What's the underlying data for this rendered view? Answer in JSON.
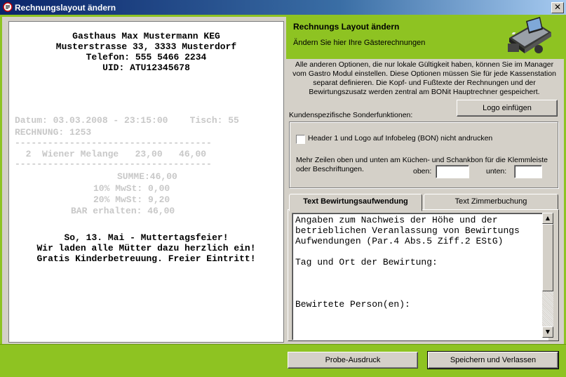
{
  "window": {
    "title": "Rechnungslayout ändern",
    "close_label": "✕"
  },
  "receipt": {
    "header_lines": [
      "Gasthaus Max Mustermann KEG",
      "Musterstrasse 33, 3333 Musterdorf",
      "Telefon: 555 5466 2234",
      "UID: ATU12345678"
    ],
    "datum_line": "Datum: 03.03.2008 - 23:15:00    Tisch: 55",
    "rechnung_line": "RECHNUNG: 1253",
    "separator": "------------------------------------",
    "item_line": "  2  Wiener Melange   23,00   46,00",
    "summe_line": "SUMME:46,00",
    "mwst10_line": "10% MwSt: 0,00",
    "mwst20_line": "20% MwSt: 9,20",
    "bar_line": "BAR erhalten: 46,00",
    "footer_lines": [
      "So, 13. Mai - Muttertagsfeier!",
      "Wir laden alle Mütter dazu herzlich ein!",
      "Gratis Kinderbetreuung. Freier Eintritt!"
    ]
  },
  "header": {
    "title": "Rechnungs Layout ändern",
    "subtitle": "Ändern Sie hier Ihre Gästerechnungen",
    "icon": "pos-terminal-icon"
  },
  "info_text": "Alle anderen Optionen, die nur lokale Gültigkeit haben, können Sie im Manager vom Gastro Modul einstellen. Diese Optionen müssen Sie für jede Kassenstation separat definieren. Die Kopf- und Fußtexte der Rechnungen und der Bewirtungszusatz werden zentral am BONit Hauptrechner gespeichert.",
  "buttons": {
    "logo": "Logo einfügen",
    "probe": "Probe-Ausdruck",
    "save": "Speichern und Verlassen"
  },
  "special": {
    "label": "Kundenspezifische Sonderfunktionen:",
    "checkbox_label": "Header 1 und Logo auf Infobeleg (BON) nicht andrucken",
    "rows_text": "Mehr Zeilen oben und unten am Küchen- und Schankbon für die Klemmleiste oder Beschriftungen.",
    "oben_label": "oben:",
    "unten_label": "unten:",
    "oben_value": "",
    "unten_value": ""
  },
  "tabs": [
    {
      "label": "Text Bewirtungsaufwendung"
    },
    {
      "label": "Text Zimmerbuchung"
    }
  ],
  "bewirtung_text": "Angaben zum Nachweis der Höhe und der\nbetrieblichen Veranlassung von Bewirtungs\nAufwendungen (Par.4 Abs.5 Ziff.2 EStG)\n\nTag und Ort der Bewirtung:\n\n\n\nBewirtete Person(en):"
}
